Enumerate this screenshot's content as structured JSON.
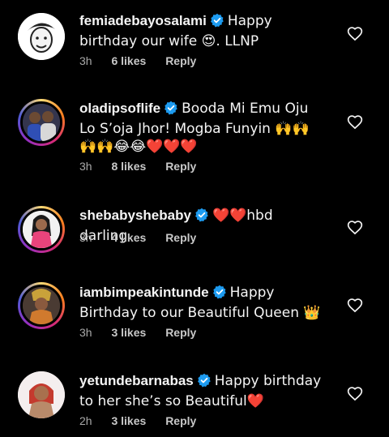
{
  "comments": [
    {
      "username": "femiadebayosalami",
      "text": "Happy birthday our wife 😍. LLNP",
      "time": "3h",
      "likes": "6 likes",
      "reply": "Reply",
      "verified": true
    },
    {
      "username": "oladipsoflife",
      "text": "Booda Mi Emu Oju Lo S’oja Jhor! Mogba Funyin 🙌🙌🙌🙌😂😂❤️❤️❤️",
      "time": "3h",
      "likes": "8 likes",
      "reply": "Reply",
      "verified": true
    },
    {
      "username": "shebabyshebaby",
      "text": "❤️❤️hbd darling",
      "time": "3h",
      "likes": "4 likes",
      "reply": "Reply",
      "verified": true
    },
    {
      "username": "iambimpeakintunde",
      "text": "Happy Birthday to our Beautiful Queen 👑",
      "time": "3h",
      "likes": "3 likes",
      "reply": "Reply",
      "verified": true
    },
    {
      "username": "yetundebarnabas",
      "text": "Happy birthday to her she’s so Beautiful❤️",
      "time": "2h",
      "likes": "3 likes",
      "reply": "Reply",
      "verified": true
    }
  ],
  "colors": {
    "background": "#000000",
    "verified_badge": "#1d9bf0",
    "meta_text": "#a8a8a8"
  },
  "icons": {
    "verified": "verified-badge-icon",
    "like": "heart-outline-icon"
  }
}
